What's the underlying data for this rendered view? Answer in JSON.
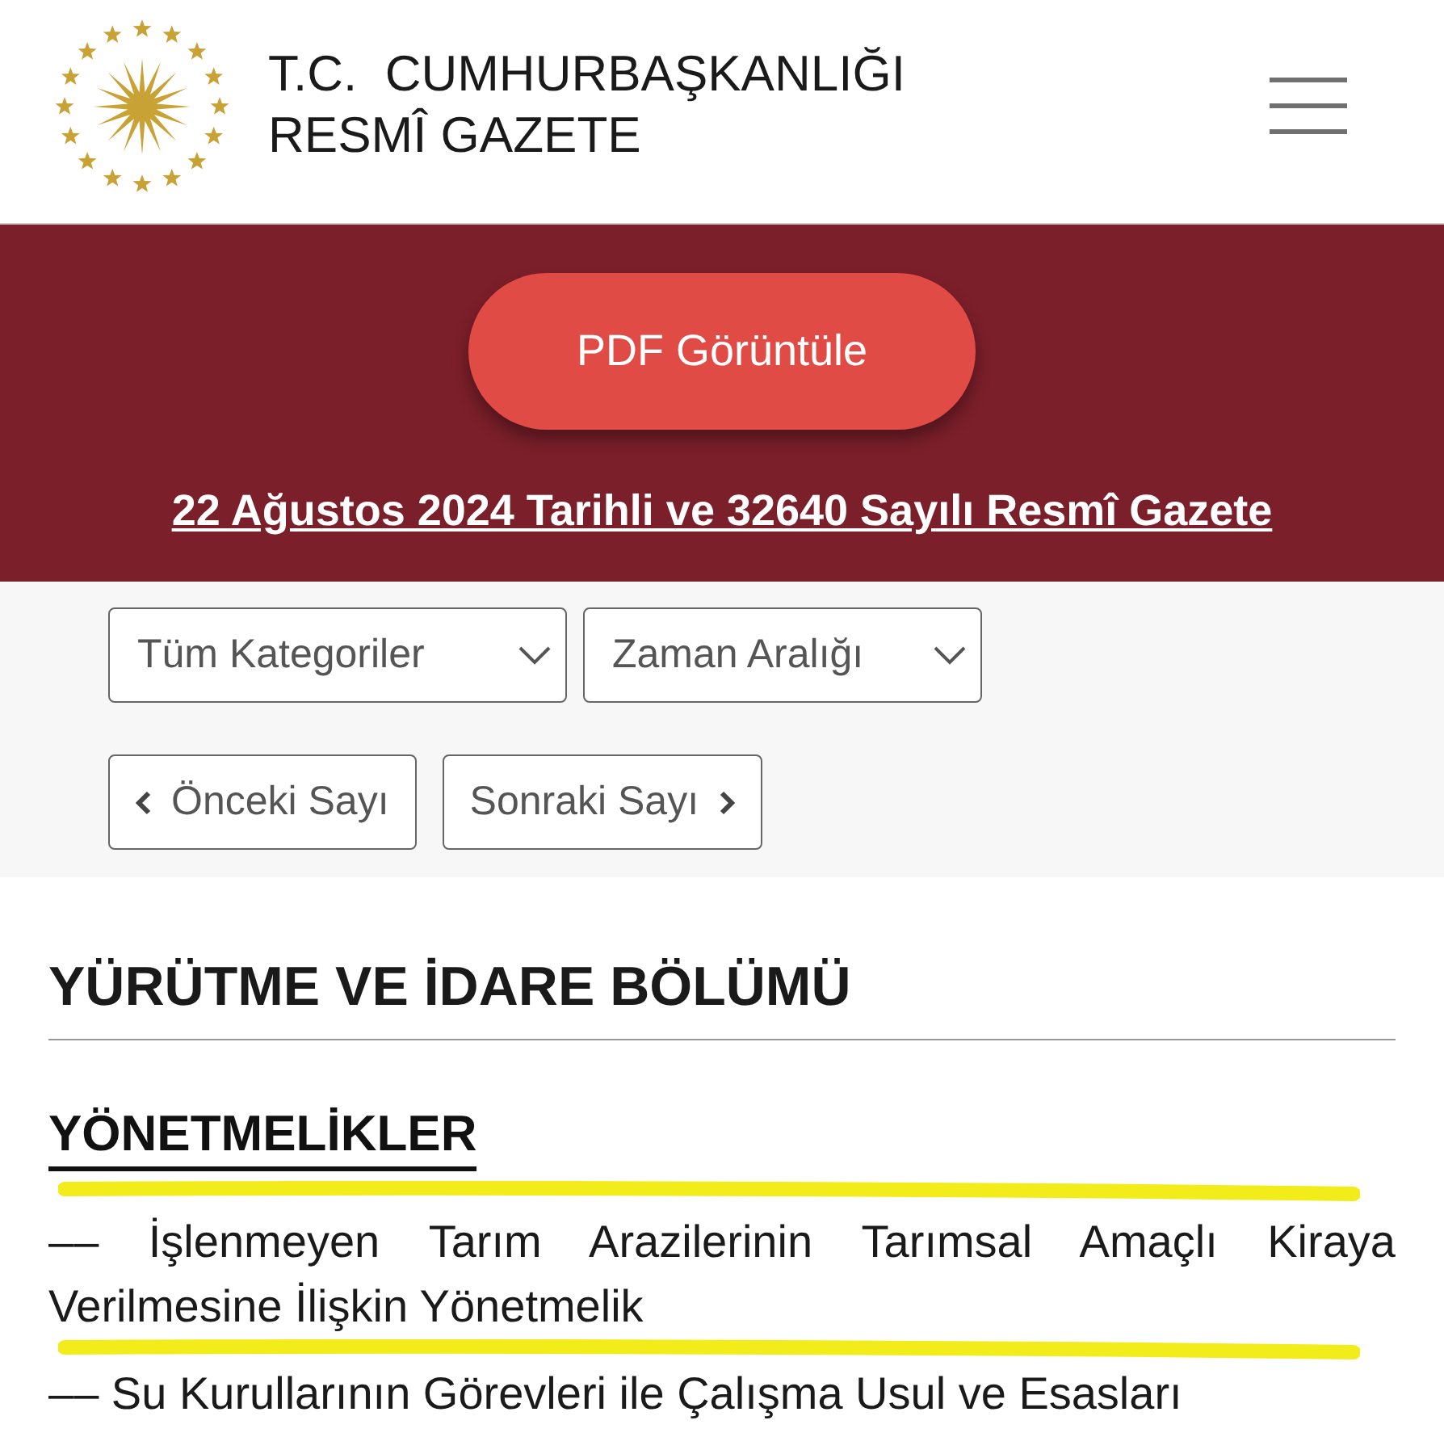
{
  "header": {
    "title_lines": [
      "T.C.  CUMHURBAŞKANLIĞI",
      "RESMÎ GAZETE"
    ]
  },
  "pdf_button": {
    "label": "PDF Görüntüle"
  },
  "issue_link": {
    "text": "22 Ağustos 2024 Tarihli ve 32640 Sayılı Resmî Gazete"
  },
  "filters": [
    {
      "label": "Tüm Kategoriler"
    },
    {
      "label": "Zaman Aralığı"
    }
  ],
  "pager": [
    {
      "label": "Önceki Sayı",
      "kind": "previous"
    },
    {
      "label": "Sonraki Sayı",
      "kind": "next"
    }
  ],
  "section": {
    "title": "YÜRÜTME VE İDARE BÖLÜMÜ"
  },
  "subsection": {
    "title": "YÖNETMELİKLER"
  },
  "items": [
    {
      "text": "–– İşlenmeyen Tarım Arazilerinin Tarımsal Amaçlı Kiraya Verilmesine İlişkin Yönetmelik",
      "highlighted": true
    },
    {
      "text": "–– Su Kurullarının Görevleri ile Çalışma Usul ve Esasları",
      "highlighted": false
    }
  ]
}
